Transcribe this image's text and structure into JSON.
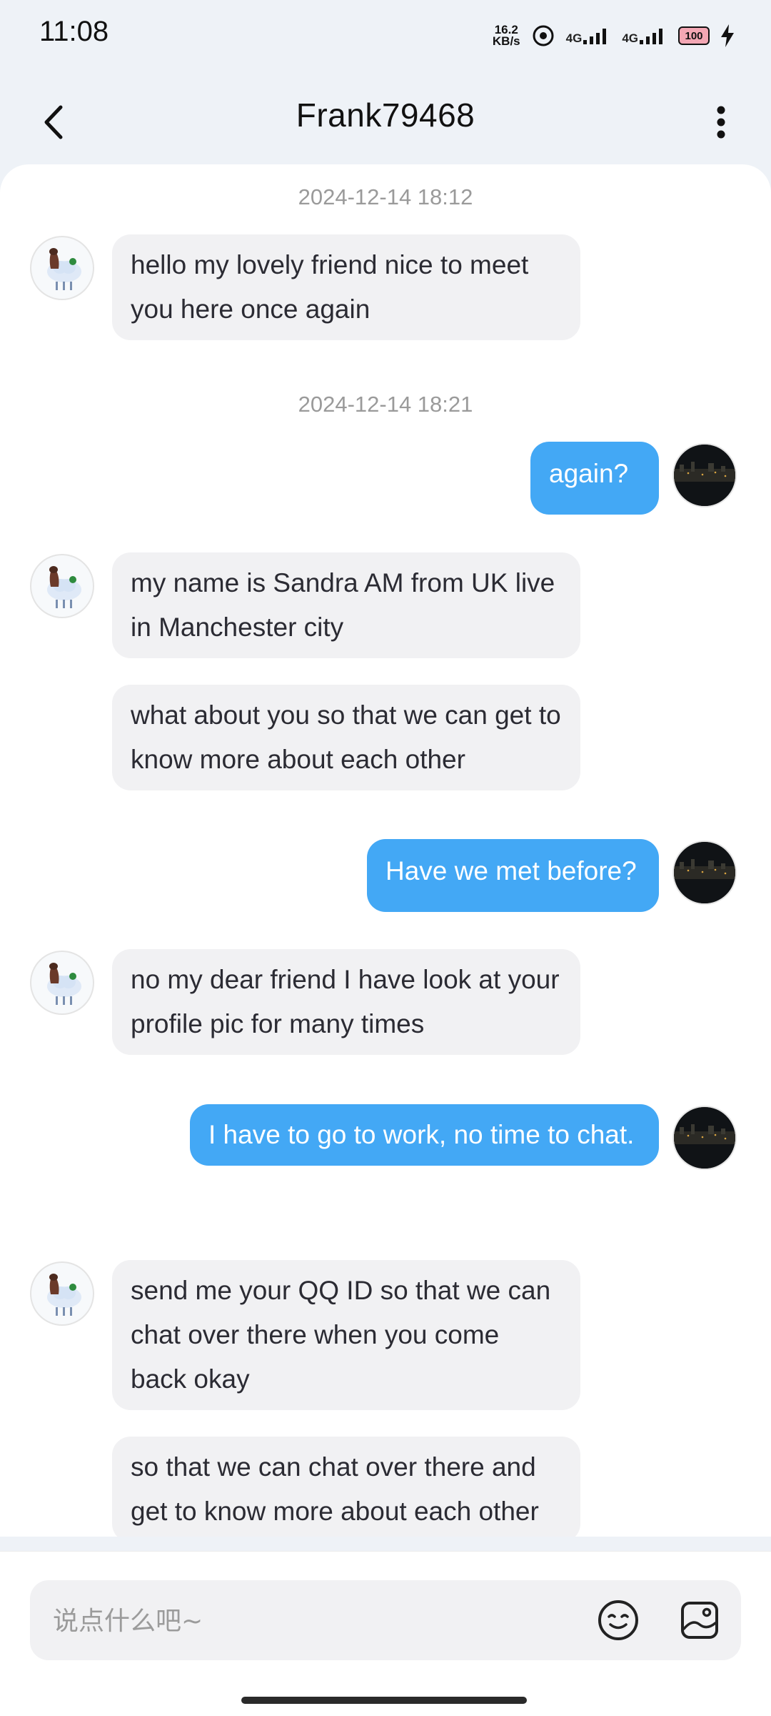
{
  "status_bar": {
    "time": "11:08",
    "net_speed_value": "16.2",
    "net_speed_unit": "KB/s",
    "signal_1": "4G",
    "signal_2": "4G",
    "battery": "100"
  },
  "header": {
    "title": "Frank79468"
  },
  "chat": {
    "timestamps": [
      "2024-12-14 18:12",
      "2024-12-14 18:21"
    ],
    "messages": [
      {
        "from": "them",
        "text": "hello my lovely friend nice to meet you here once again"
      },
      {
        "from": "me",
        "text": "again?"
      },
      {
        "from": "them",
        "text": "my name is Sandra AM from UK live in Manchester city"
      },
      {
        "from": "them",
        "text": "what about you so that we can get to know more about each other"
      },
      {
        "from": "me",
        "text": "Have we met before?"
      },
      {
        "from": "them",
        "text": "no my dear friend I have look at your profile pic for many times"
      },
      {
        "from": "me",
        "text": "I have to go to work, no time to chat."
      },
      {
        "from": "them",
        "text": "send me your QQ ID so that we can chat over there when you come back okay"
      },
      {
        "from": "them",
        "text": "so that we can chat over there and get to know more about each other"
      }
    ]
  },
  "input": {
    "placeholder": "说点什么吧~",
    "value": ""
  },
  "colors": {
    "outgoing_bubble": "#43a8f5",
    "incoming_bubble": "#f1f1f3",
    "background": "#eef2f7"
  },
  "icons": [
    "back-arrow-icon",
    "more-options-icon",
    "emoji-icon",
    "image-icon"
  ]
}
